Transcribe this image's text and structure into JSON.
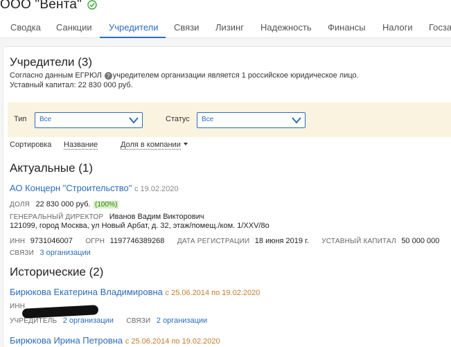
{
  "header": {
    "company_name": "ООО \"Вента\"",
    "verified_icon": "check-circle-icon",
    "accent_color": "#2b6cb8"
  },
  "tabs": [
    {
      "label": "Сводка"
    },
    {
      "label": "Санкции"
    },
    {
      "label": "Учредители"
    },
    {
      "label": "Связи"
    },
    {
      "label": "Лизинг"
    },
    {
      "label": "Надежность"
    },
    {
      "label": "Финансы"
    },
    {
      "label": "Налоги"
    },
    {
      "label": "Госза"
    }
  ],
  "active_tab": "Учредители",
  "founders_section": {
    "title": "Учредители (3)",
    "egrul_text_before": "Согласно данным ЕГРЮЛ",
    "egrul_text_after": "учредителем организации является 1 российское юридическое лицо.",
    "capital_text": "Уставный капитал: 22 830 000 руб."
  },
  "filters": {
    "type_label": "Тип",
    "type_value": "Все",
    "status_label": "Статус",
    "status_value": "Все"
  },
  "sorting": {
    "label": "Сортировка",
    "by_name": "Название",
    "by_share": "Доля в компании"
  },
  "current": {
    "title": "Актуальные (1)",
    "company": {
      "name": "АО Концерн \"Строительство\"",
      "since": "с 19.02.2020",
      "share_label": "ДОЛЯ",
      "share_value": "22 830 000 руб.",
      "share_pct": "(100%)",
      "director_label": "ГЕНЕРАЛЬНЫЙ ДИРЕКТОР",
      "director_name": "Иванов Вадим Викторович",
      "address": "121099, город Москва, ул Новый Арбат, д. 32, этаж/помещ./ком. 1/XXV/8о",
      "inn_label": "ИНН",
      "inn": "9731046007",
      "ogrn_label": "ОГРН",
      "ogrn": "1197746389268",
      "reg_label": "ДАТА РЕГИСТРАЦИИ",
      "reg_date": "18 июня 2019 г.",
      "capital_label": "УСТАВНЫЙ КАПИТАЛ",
      "capital_value": "50 000 000",
      "links_label": "СВЯЗИ",
      "links_value": "3 организации"
    }
  },
  "historical": {
    "title": "Исторические (2)",
    "people": [
      {
        "name": "Бирюкова Екатерина Владимировна",
        "period": "с 25.06.2014 по 19.02.2020",
        "inn_label": "ИНН",
        "founder_label": "УЧРЕДИТЕЛЬ",
        "founder_value": "2 организации",
        "links_label": "СВЯЗИ",
        "links_value": "2 организации"
      },
      {
        "name": "Бирюкова Ирина Петровна",
        "period": "с 25.06.2014 по 19.02.2020"
      }
    ]
  }
}
